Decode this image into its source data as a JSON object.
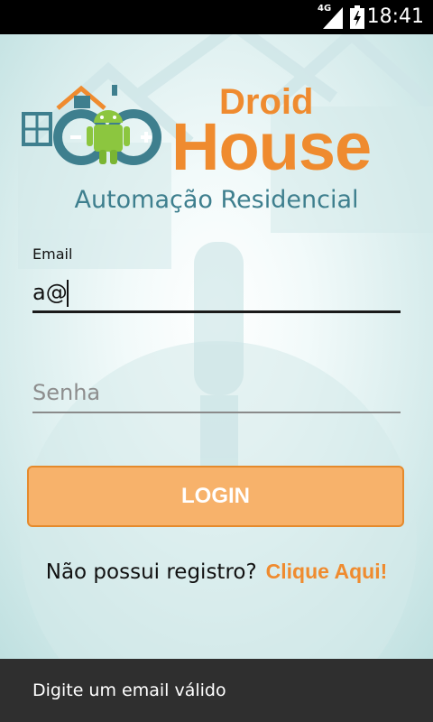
{
  "status_bar": {
    "network": "4G",
    "time": "18:41",
    "icons": [
      "signal-icon",
      "battery-charging-icon"
    ]
  },
  "logo": {
    "brand_top": "Droid",
    "brand_bottom": "House"
  },
  "subtitle": "Automação Residencial",
  "form": {
    "email_label": "Email",
    "email_value": "a@",
    "password_placeholder": "Senha",
    "login_label": "LOGIN"
  },
  "register": {
    "text": "Não possui registro?",
    "link": "Clique Aqui!"
  },
  "toast": {
    "message": "Digite um email válido"
  },
  "colors": {
    "accent": "#ef8b2f",
    "teal": "#3e7f8e",
    "button": "#f7b26b"
  }
}
